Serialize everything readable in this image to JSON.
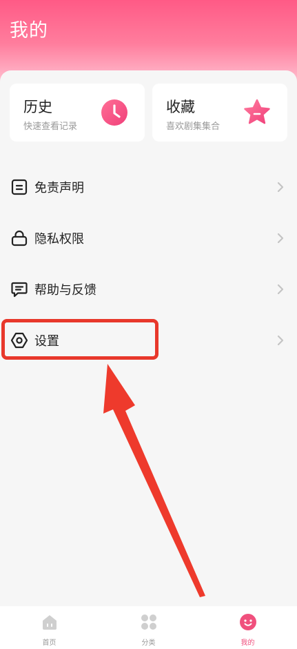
{
  "header": {
    "title": "我的"
  },
  "cards": {
    "history": {
      "title": "历史",
      "subtitle": "快速查看记录",
      "icon": "clock-icon"
    },
    "favorites": {
      "title": "收藏",
      "subtitle": "喜欢剧集集合",
      "icon": "star-icon"
    }
  },
  "menu": {
    "items": [
      {
        "label": "免责声明",
        "icon": "document-icon"
      },
      {
        "label": "隐私权限",
        "icon": "lock-icon"
      },
      {
        "label": "帮助与反馈",
        "icon": "chat-icon"
      },
      {
        "label": "设置",
        "icon": "hexagon-settings-icon"
      }
    ]
  },
  "tabbar": {
    "items": [
      {
        "label": "首页",
        "icon": "home-icon",
        "active": false
      },
      {
        "label": "分类",
        "icon": "grid-icon",
        "active": false
      },
      {
        "label": "我的",
        "icon": "smiley-icon",
        "active": true
      }
    ]
  },
  "colors": {
    "accent": "#f0507d",
    "header_top": "#ff5a86",
    "highlight": "#e8382b"
  }
}
